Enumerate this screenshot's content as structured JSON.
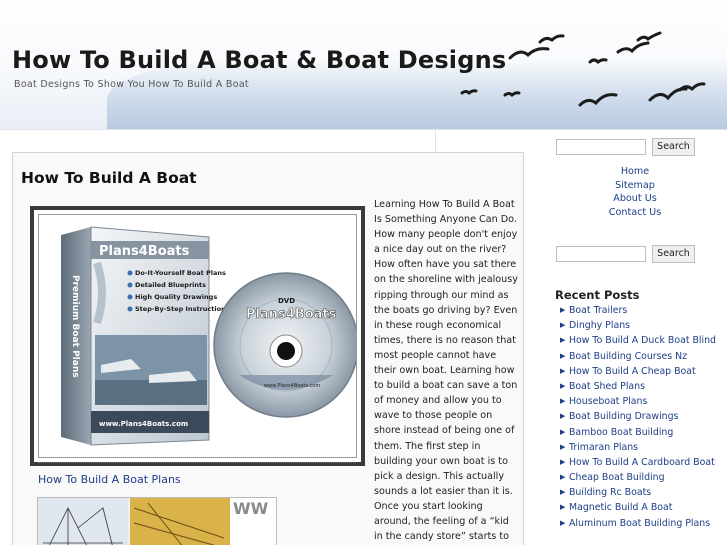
{
  "header": {
    "title": "How To Build A Boat & Boat Designs",
    "tagline": "Boat Designs To Show You How To Build A Boat"
  },
  "post": {
    "title": "How To Build A Boat",
    "product_image": {
      "box_brand": "Plans4Boats",
      "box_side_text": "Premium Boat Plans",
      "box_bullets": [
        "Do-It-Yourself Boat Plans",
        "Detailed Blueprints",
        "High Quality Drawings",
        "Step-By-Step Instructions"
      ],
      "box_url": "www.Plans4Boats.com",
      "dvd_label": "DVD",
      "dvd_brand": "Plans4Boats",
      "dvd_url": "www.Plans4Boats.com"
    },
    "caption_link": "How To Build A Boat Plans",
    "thumb_text": "WW",
    "body": "Learning How To Build A Boat Is Something Anyone Can Do. How many people don't enjoy a nice day out on the river? How often have you sat there on the shoreline with jealousy ripping through our mind as the boats go driving by? Even in these rough economical times, there is no reason that most people cannot have their own boat. Learning how to build a boat can save a ton of money and allow you to wave to those people on shore instead of being one of them. The first step in building your own boat is to pick a design. This actually sounds a lot easier than it is. Once you start looking around, the feeling of a “kid in the candy store” starts to settle in. While"
  },
  "sidebar": {
    "search_button_label": "Search",
    "search_button_label_2": "Search",
    "page_links": [
      "Home",
      "Sitemap",
      "About Us",
      "Contact Us"
    ],
    "recent_heading": "Recent Posts",
    "recent_posts": [
      "Boat Trailers",
      "Dinghy Plans",
      "How To Build A Duck Boat Blind",
      "Boat Building Courses Nz",
      "How To Build A Cheap Boat",
      "Boat Shed Plans",
      "Houseboat Plans",
      "Boat Building Drawings",
      "Bamboo Boat Building",
      "Trimaran Plans",
      "How To Build A Cardboard Boat",
      "Cheap Boat Building",
      "Building Rc Boats",
      "Magnetic Build A Boat",
      "Aluminum Boat Building Plans"
    ]
  },
  "colors": {
    "link": "#1d3f88",
    "sky": "#b7c8df",
    "box_blue": "#3b6fb0"
  }
}
